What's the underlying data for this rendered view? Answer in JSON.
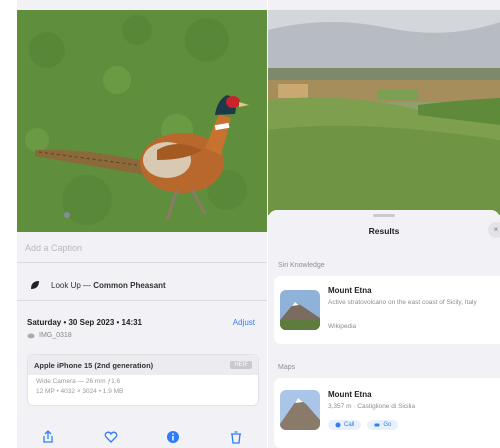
{
  "left_panel": {
    "caption_placeholder": "Add a Caption",
    "lookup_label": "Look Up",
    "lookup_subject": "Common Pheasant",
    "date_text": "Saturday • 30 Sep 2023 • 14:31",
    "adjust_label": "Adjust",
    "filename_text": "IMG_0318",
    "device_name": "Apple iPhone 15 (2nd generation)",
    "format_badge": "HEIF",
    "lens_line": "Wide Camera — 26 mm ƒ1.6",
    "specs_line": "12 MP • 4032 × 3024 • 1.9 MB",
    "toolbar": [
      "share-icon",
      "heart-icon",
      "info-icon",
      "trash-icon"
    ]
  },
  "right_panel": {
    "sheet_title": "Results",
    "close_label": "×",
    "sections": {
      "siri_knowledge": "Siri Knowledge",
      "maps": "Maps"
    },
    "knowledge_result": {
      "title": "Mount Etna",
      "description": "Active stratovolcano on the east coast of Sicily, Italy",
      "source": "Wikipedia"
    },
    "maps_result": {
      "title": "Mount Etna",
      "subtitle": "3,357 m · Castiglione di Sicilia",
      "chip_call": "Call",
      "chip_go": "Go"
    }
  },
  "colors": {
    "accent": "#2f7cf6",
    "grass": "#6d9b46",
    "background": "#f2f2f6"
  }
}
